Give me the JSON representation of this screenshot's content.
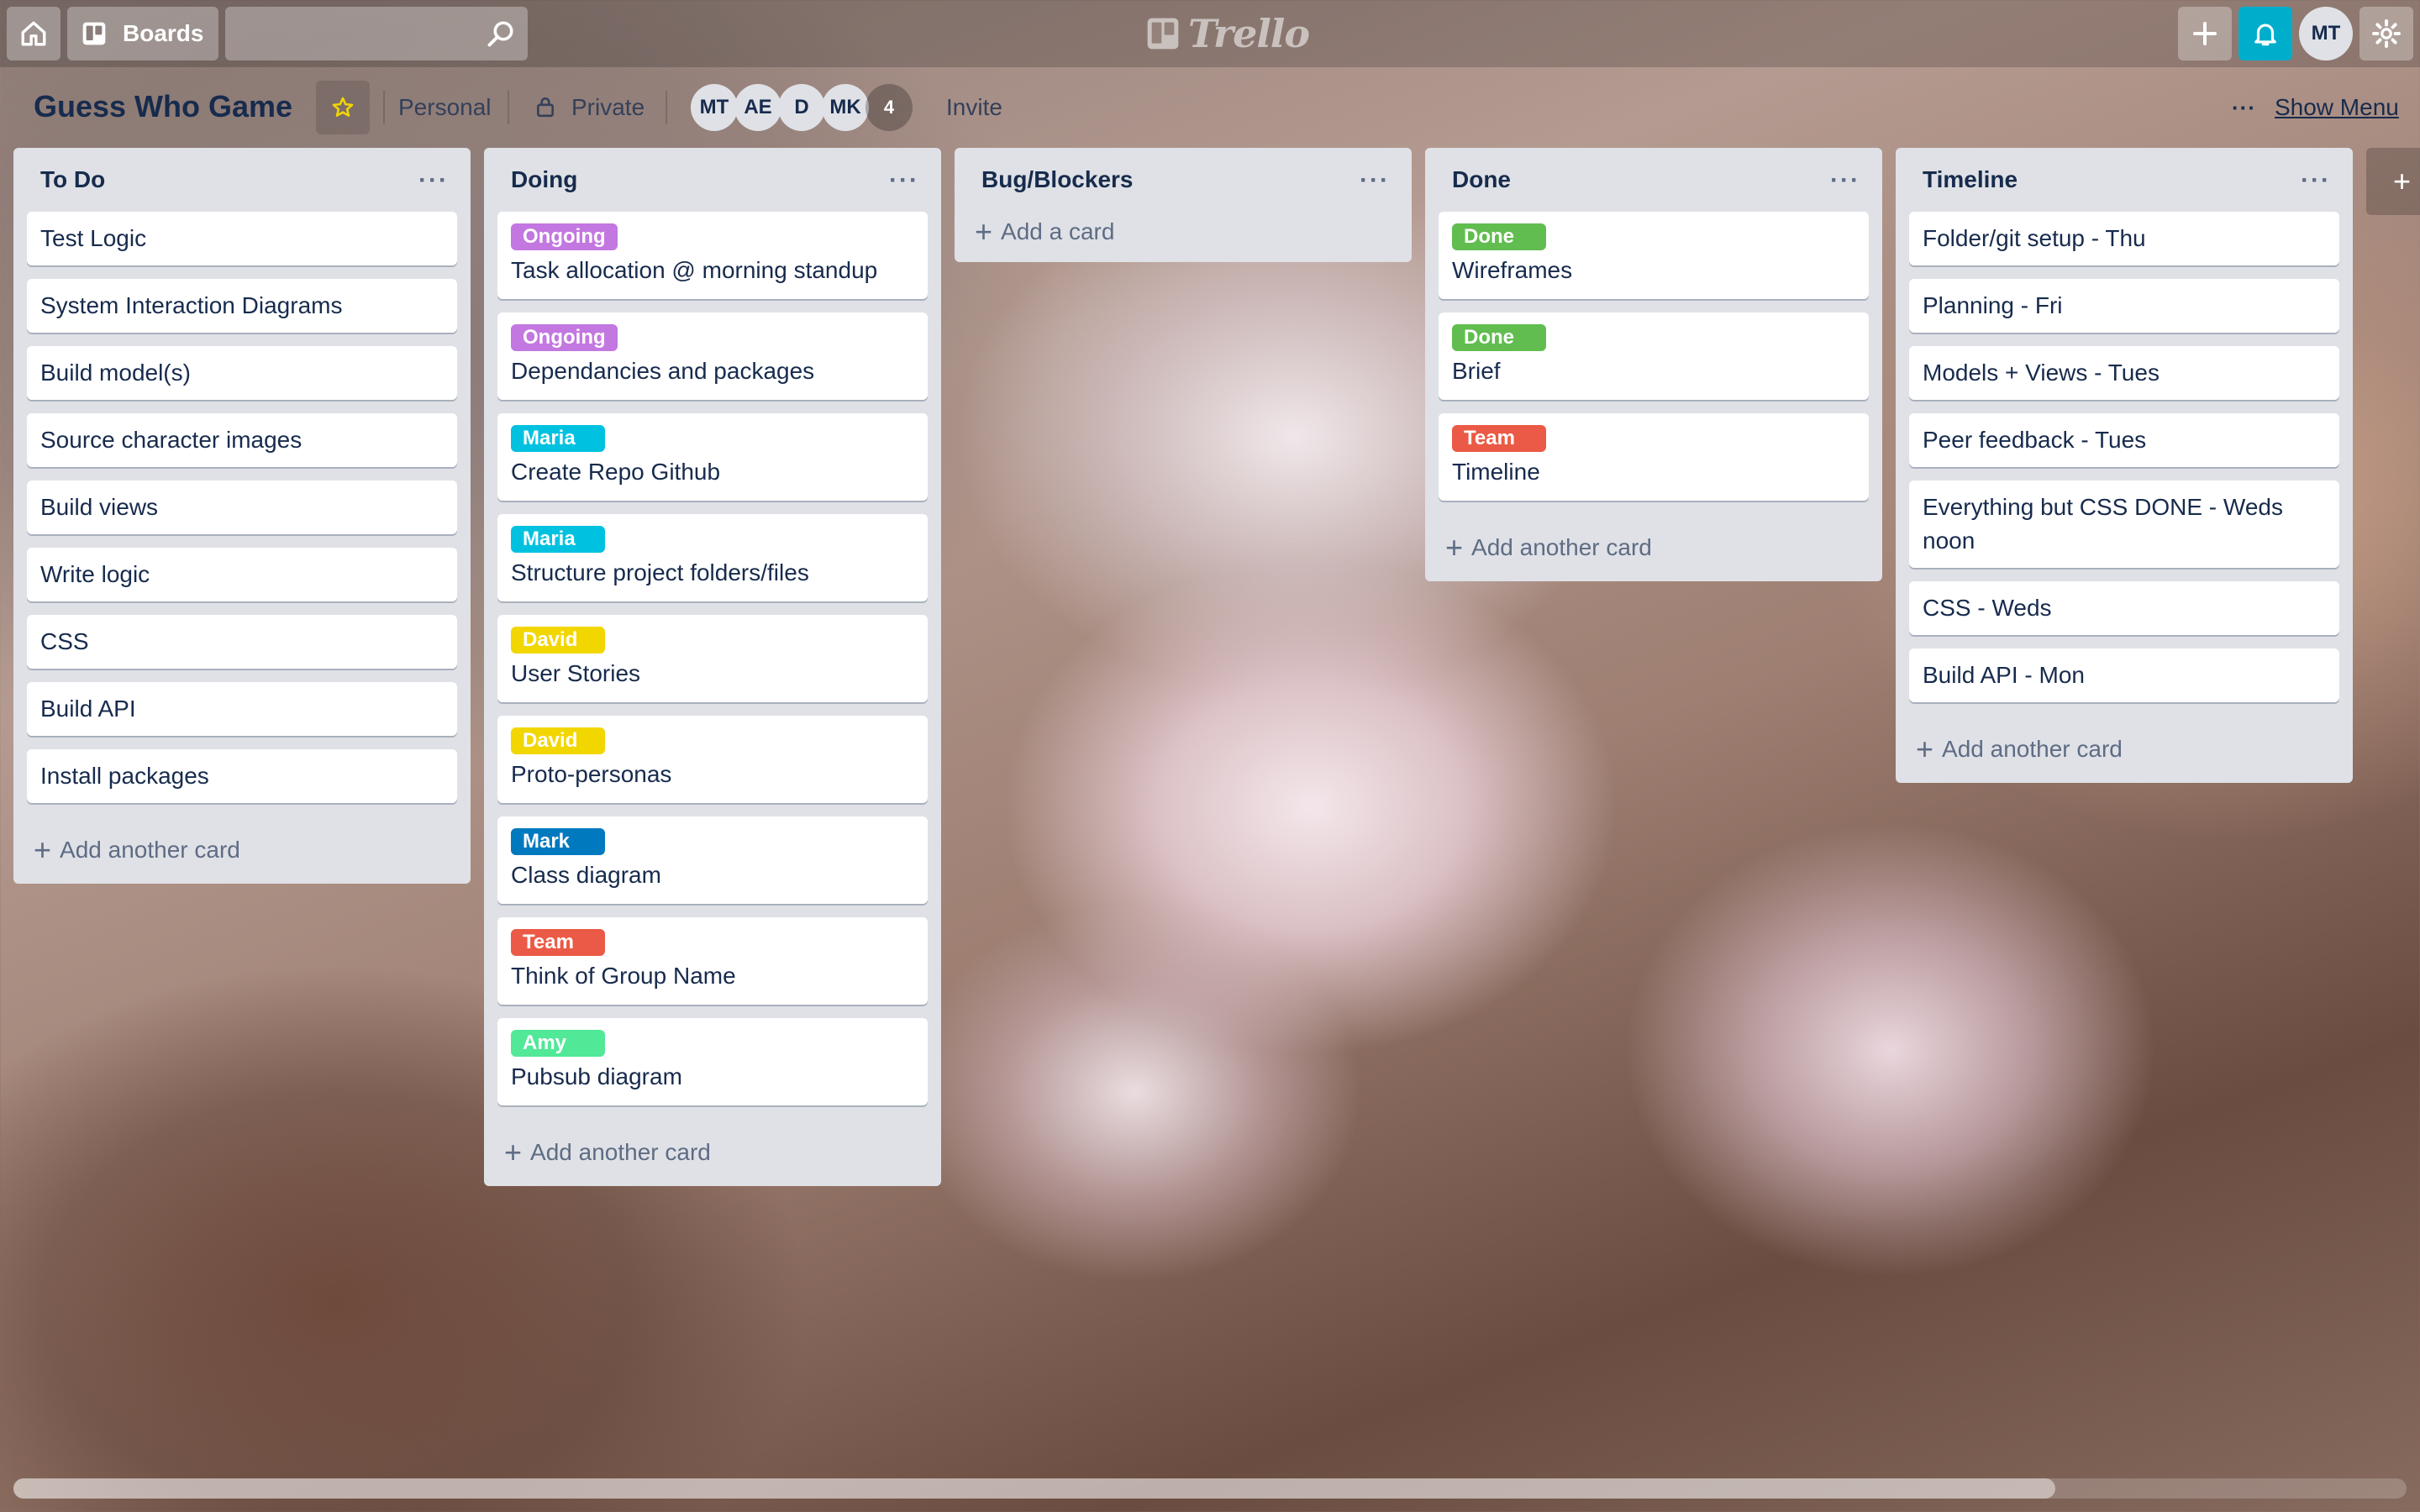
{
  "topbar": {
    "home_icon": "home-icon",
    "boards_label": "Boards",
    "search_placeholder": "",
    "logo_text": "Trello",
    "avatar_initials": "MT"
  },
  "board": {
    "title": "Guess Who Game",
    "visibility_team": "Personal",
    "visibility_privacy": "Private",
    "members": [
      "MT",
      "AE",
      "D",
      "MK"
    ],
    "member_overflow": "4",
    "invite_label": "Invite",
    "show_menu_label": "Show Menu"
  },
  "labels_colors": {
    "Ongoing": "#c377e0",
    "Maria": "#00c2e0",
    "David": "#f2d600",
    "Mark": "#0079bf",
    "Team": "#eb5a46",
    "Amy": "#51e898",
    "Done": "#61bd4f"
  },
  "lists": [
    {
      "title": "To Do",
      "cards": [
        {
          "title": "Test Logic"
        },
        {
          "title": "System Interaction Diagrams"
        },
        {
          "title": "Build model(s)"
        },
        {
          "title": "Source character images"
        },
        {
          "title": "Build views"
        },
        {
          "title": "Write logic"
        },
        {
          "title": "CSS"
        },
        {
          "title": "Build API"
        },
        {
          "title": "Install packages"
        }
      ],
      "add_label": "Add another card"
    },
    {
      "title": "Doing",
      "cards": [
        {
          "label": "Ongoing",
          "title": "Task allocation @ morning standup"
        },
        {
          "label": "Ongoing",
          "title": "Dependancies and packages"
        },
        {
          "label": "Maria",
          "title": "Create Repo Github"
        },
        {
          "label": "Maria",
          "title": "Structure project folders/files"
        },
        {
          "label": "David",
          "title": "User Stories"
        },
        {
          "label": "David",
          "title": "Proto-personas"
        },
        {
          "label": "Mark",
          "title": "Class diagram"
        },
        {
          "label": "Team",
          "title": "Think of Group Name"
        },
        {
          "label": "Amy",
          "title": "Pubsub diagram"
        }
      ],
      "add_label": "Add another card"
    },
    {
      "title": "Bug/Blockers",
      "cards": [],
      "add_label": "Add a card"
    },
    {
      "title": "Done",
      "cards": [
        {
          "label": "Done",
          "title": "Wireframes"
        },
        {
          "label": "Done",
          "title": "Brief"
        },
        {
          "label": "Team",
          "title": "Timeline"
        }
      ],
      "add_label": "Add another card"
    },
    {
      "title": "Timeline",
      "cards": [
        {
          "title": "Folder/git setup - Thu"
        },
        {
          "title": "Planning - Fri"
        },
        {
          "title": "Models + Views - Tues"
        },
        {
          "title": "Peer feedback - Tues"
        },
        {
          "title": "Everything but CSS DONE - Weds noon"
        },
        {
          "title": "CSS - Weds"
        },
        {
          "title": "Build API - Mon"
        }
      ],
      "add_label": "Add another card"
    }
  ]
}
